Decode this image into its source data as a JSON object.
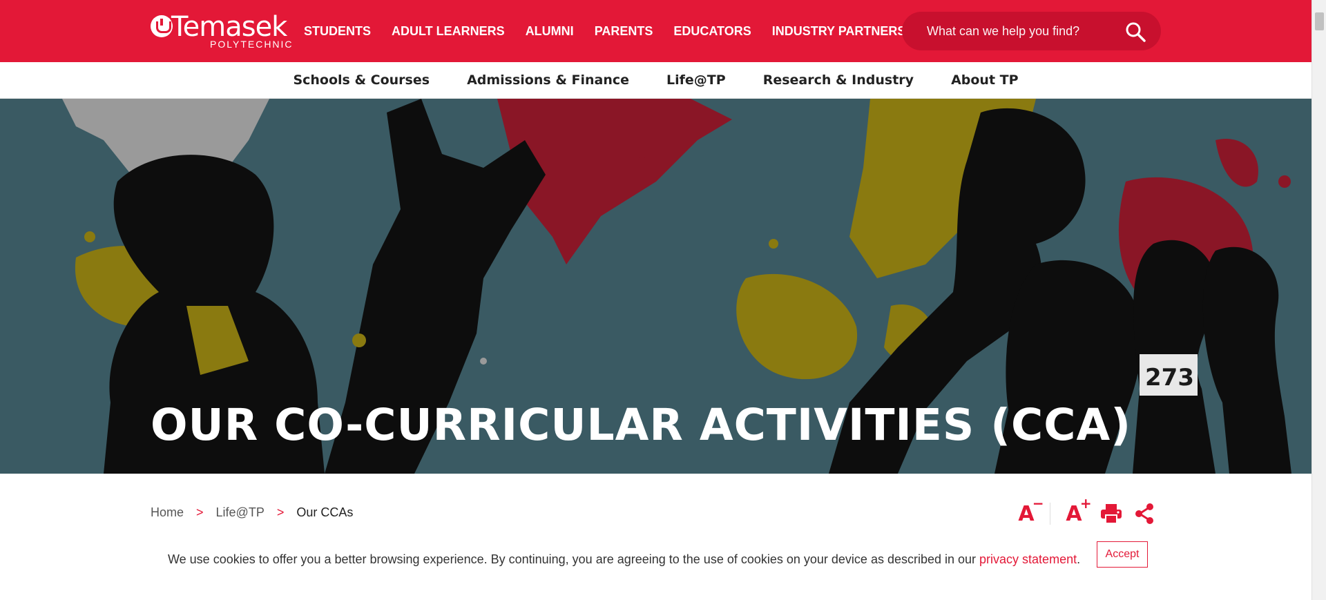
{
  "logo": {
    "name": "Temasek",
    "sub": "POLYTECHNIC"
  },
  "top_nav": {
    "items": [
      "STUDENTS",
      "ADULT LEARNERS",
      "ALUMNI",
      "PARENTS",
      "EDUCATORS",
      "INDUSTRY PARTNERS"
    ]
  },
  "search": {
    "placeholder": "What can we help you find?",
    "icon": "search-icon"
  },
  "sub_nav": {
    "items": [
      "Schools & Courses",
      "Admissions & Finance",
      "Life@TP",
      "Research & Industry",
      "About TP"
    ]
  },
  "hero": {
    "title": "OUR CO-CURRICULAR ACTIVITIES (CCA)"
  },
  "breadcrumb": {
    "items": [
      "Home",
      "Life@TP",
      "Our CCAs"
    ],
    "separator": ">"
  },
  "tools": {
    "decrease_label": "A",
    "decrease_sup": "−",
    "increase_label": "A",
    "increase_sup": "+",
    "print_icon": "print-icon",
    "share_icon": "share-icon"
  },
  "cookie": {
    "text": "We use cookies to offer you a better browsing experience. By continuing, you are agreeing to the use of cookies on your device as described in our ",
    "link": "privacy statement",
    "end": ".",
    "accept_label": "Accept"
  },
  "colors": {
    "brand_red": "#e31837",
    "hero_bg": "#3a5a63",
    "splash_gold": "#8a7a10",
    "splash_red": "#8a1626"
  }
}
